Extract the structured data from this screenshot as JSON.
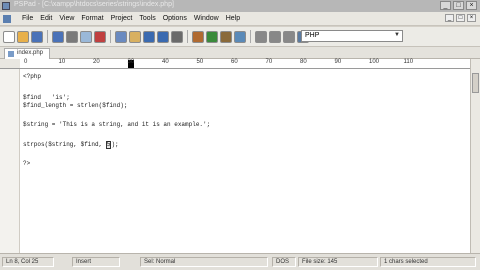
{
  "window": {
    "title": "PSPad - [C:\\xampp\\htdocs\\series\\strings\\index.php]"
  },
  "menu": {
    "items": [
      "File",
      "Edit",
      "View",
      "Format",
      "Project",
      "Tools",
      "Options",
      "Window",
      "Help"
    ]
  },
  "toolbar": {
    "language": "PHP",
    "icons": [
      "new-icon",
      "open-icon",
      "save-icon",
      "save-all-icon",
      "print-icon",
      "preview-icon",
      "cut-icon",
      "copy-icon",
      "paste-icon",
      "undo-icon",
      "redo-icon",
      "find-icon",
      "replace-icon",
      "goto-icon",
      "tools-icon",
      "color-icon",
      "zoom-in-icon",
      "zoom-out-icon",
      "zoom-reset-icon",
      "book-icon"
    ],
    "icon_colors": [
      "#ffffff",
      "#e8b04a",
      "#4a72b8",
      "#4a72b8",
      "#7a7a7a",
      "#9ab8d8",
      "#c04040",
      "#6a8ac0",
      "#d8b060",
      "#3a6ab0",
      "#3a6ab0",
      "#6a6a6a",
      "#b06a30",
      "#3a8a3a",
      "#8a6a3a",
      "#5a8ab8",
      "#888888",
      "#888888",
      "#888888",
      "#5a7aa0"
    ]
  },
  "tab": {
    "label": "index.php"
  },
  "ruler": {
    "ticks": [
      "0",
      "10",
      "20",
      "30",
      "40",
      "50",
      "60",
      "70",
      "80",
      "90",
      "100",
      "110"
    ]
  },
  "code": {
    "lines": [
      "<?php",
      "",
      "$find   'is';",
      "$find_length = strlen($find);",
      "",
      "$string = 'This is a string, and it is an example.';",
      "",
      "strpos($string, $find, ",
      "",
      "?>"
    ],
    "cursor_char": "5",
    "cursor_tail": ");"
  },
  "status": {
    "position": "Ln 8, Col 25",
    "mode": "Insert",
    "syntax": "Sel: Normal",
    "encoding": "DOS",
    "file_size": "File size: 145",
    "message": "1 chars selected"
  }
}
